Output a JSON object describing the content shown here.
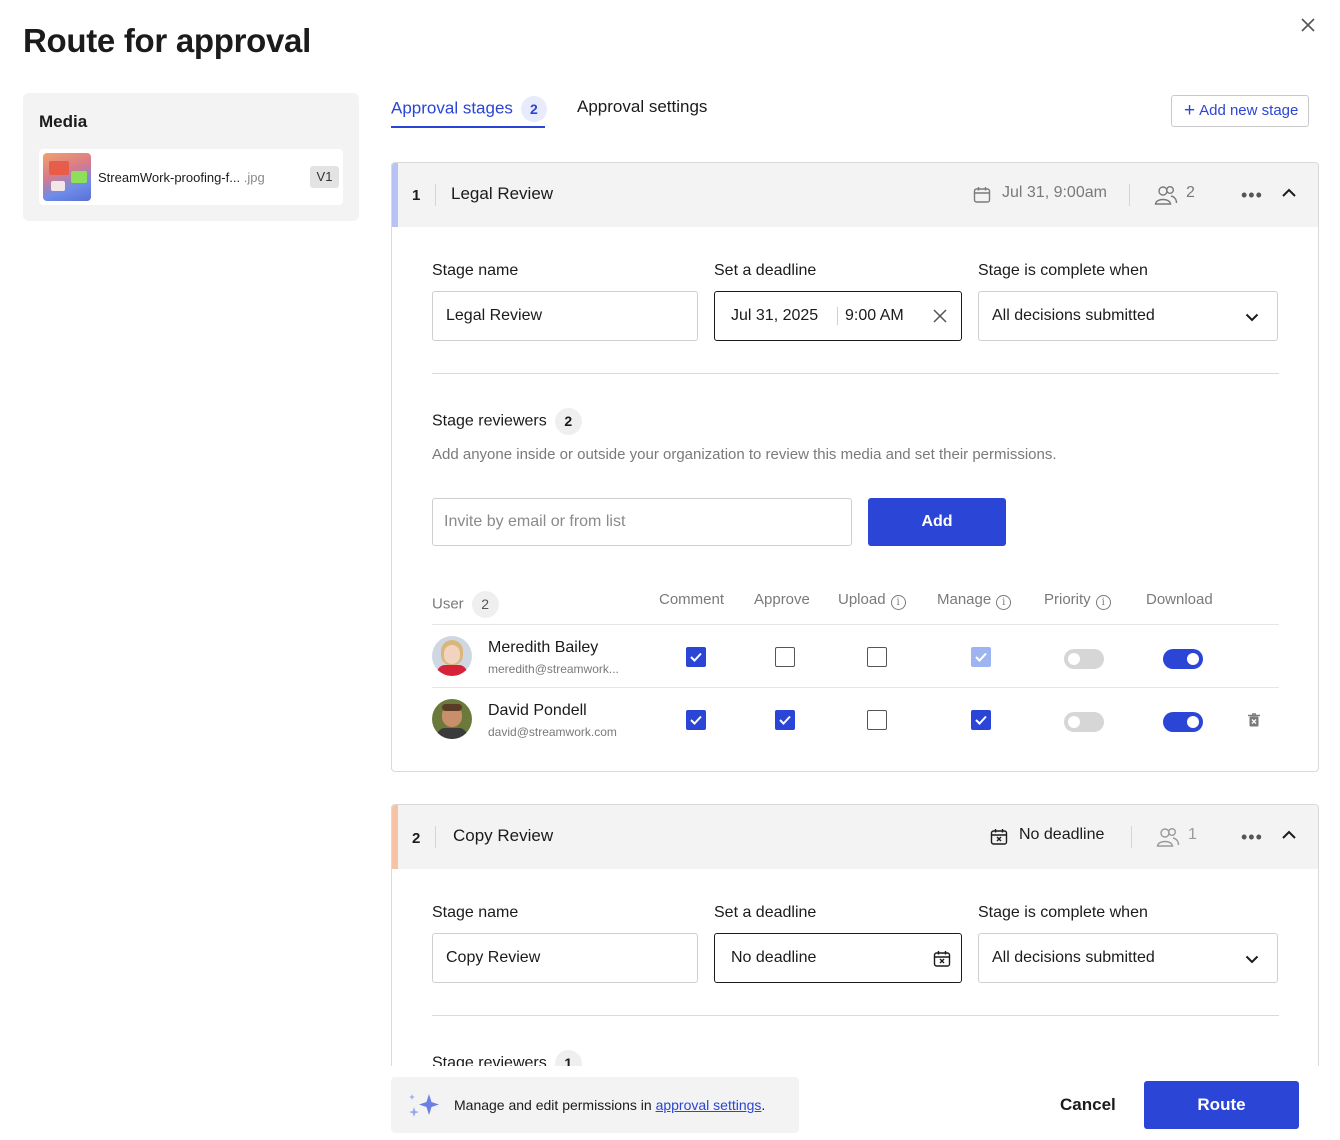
{
  "page": {
    "title": "Route for approval"
  },
  "media": {
    "heading": "Media",
    "file_name": "StreamWork-proofing-f...",
    "file_ext": ".jpg",
    "version": "V1"
  },
  "tabs": {
    "approval_stages": "Approval stages",
    "approval_stages_count": "2",
    "approval_settings": "Approval settings"
  },
  "add_stage_label": "Add new stage",
  "labels": {
    "stage_name": "Stage name",
    "set_deadline": "Set a deadline",
    "complete_when": "Stage is complete when",
    "stage_reviewers": "Stage reviewers",
    "reviewers_desc": "Add anyone inside or outside your organization to review this media and set their permissions.",
    "invite_placeholder": "Invite by email or from list",
    "add_button": "Add"
  },
  "columns": {
    "user": "User",
    "comment": "Comment",
    "approve": "Approve",
    "upload": "Upload",
    "manage": "Manage",
    "priority": "Priority",
    "download": "Download"
  },
  "stages": [
    {
      "number": "1",
      "name": "Legal Review",
      "deadline_summary": "Jul 31, 9:00am",
      "reviewer_count": "2",
      "deadline_date": "Jul 31, 2025",
      "deadline_time": "9:00 AM",
      "complete_when": "All decisions submitted",
      "accent_color": "#b9c2f5",
      "users": [
        {
          "name": "Meredith Bailey",
          "email": "meredith@streamwork...",
          "comment": true,
          "approve": false,
          "upload": false,
          "manage": true,
          "manage_disabled": true,
          "priority": false,
          "download": true
        },
        {
          "name": "David Pondell",
          "email": "david@streamwork.com",
          "comment": true,
          "approve": true,
          "upload": false,
          "manage": true,
          "priority": false,
          "download": true
        }
      ]
    },
    {
      "number": "2",
      "name": "Copy Review",
      "deadline_summary": "No deadline",
      "reviewer_count": "1",
      "deadline_field": "No deadline",
      "complete_when": "All decisions submitted",
      "accent_color": "#f6c3a6"
    }
  ],
  "footer": {
    "note_prefix": "Manage and edit permissions in ",
    "note_link": "approval settings",
    "note_suffix": ".",
    "cancel_label": "Cancel",
    "route_label": "Route"
  },
  "colors": {
    "accent": "#2b45d6"
  }
}
